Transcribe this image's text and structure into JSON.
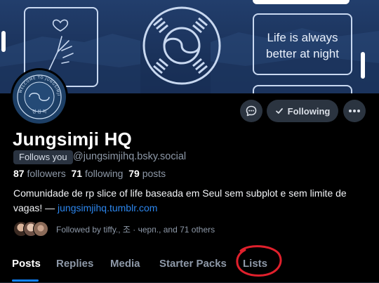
{
  "banner": {
    "text_line1": "Life is always",
    "text_line2": "better at night",
    "avatar_text_top": "WELCOME TO JUNGSIMJI",
    "avatar_text_bottom": "정 심 지"
  },
  "actions": {
    "following_label": "Following"
  },
  "profile": {
    "display_name": "Jungsimji HQ",
    "follows_you": "Follows you",
    "handle": "@jungsimjihq.bsky.social",
    "followers_count": "87",
    "followers_label": "followers",
    "following_count": "71",
    "following_label": "following",
    "posts_count": "79",
    "posts_label": "posts",
    "bio_text": "Comunidade de rp slice of life baseada em Seul sem subplot e sem limite de vagas! — ",
    "bio_link": "jungsimjihq.tumblr.com",
    "followed_by": "Followed by tiffy., 조 · черп., and 71 others"
  },
  "tabs": [
    {
      "label": "Posts"
    },
    {
      "label": "Replies"
    },
    {
      "label": "Media"
    },
    {
      "label": "Starter Packs"
    },
    {
      "label": "Lists"
    }
  ],
  "colors": {
    "accent": "#1083fe",
    "link": "#2c86ee",
    "annotation": "#e0202c"
  },
  "icons": [
    "heart-hand-icon",
    "taegeuk-icon",
    "chat-icon",
    "check-icon",
    "more-icon"
  ]
}
